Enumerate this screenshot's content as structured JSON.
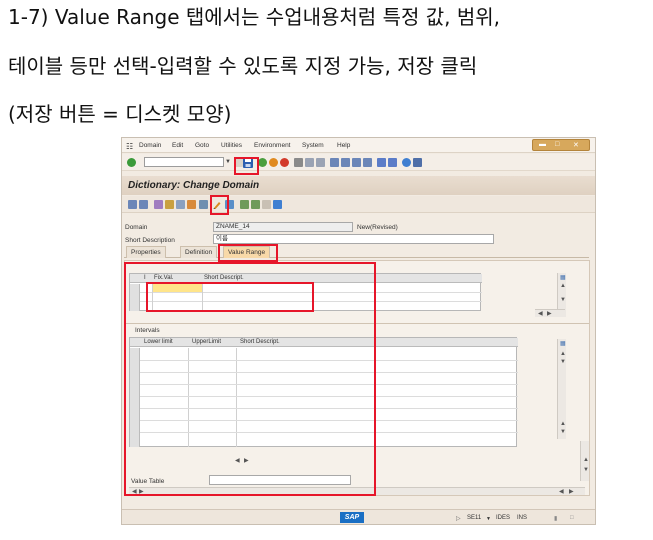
{
  "caption": {
    "line1": "1-7) Value Range 탭에서는 수업내용처럼 특정 값, 범위,",
    "line2": "테이블 등만 선택-입력할 수 있도록 지정 가능, 저장 클릭",
    "line3": "(저장 버튼 = 디스켓 모양)"
  },
  "menu": [
    "Domain",
    "Edit",
    "Goto",
    "Utilities",
    "Environment",
    "System",
    "Help"
  ],
  "toolbar": {
    "save_icon": "floppy-disk-icon"
  },
  "screen_title": "Dictionary: Change Domain",
  "application_toolbar": {
    "edit_icon": "pencil-icon"
  },
  "fields": {
    "domain_label": "Domain",
    "domain_value": "ZNAME_14",
    "domain_status": "New(Revised)",
    "short_desc_label": "Short Description",
    "short_desc_value": "이름"
  },
  "tabs": [
    "Properties",
    "Definition",
    "Value Range"
  ],
  "active_tab": "Value Range",
  "fixed_values_table": {
    "columns": [
      "I",
      "Fix.Val.",
      "Short Descript."
    ]
  },
  "intervals": {
    "title": "Intervals",
    "columns": [
      "Lower limit",
      "UpperLimit",
      "Short Descript."
    ]
  },
  "value_table": {
    "label": "Value Table",
    "value": ""
  },
  "status_bar": {
    "logo": "SAP",
    "transaction": "SE11",
    "system": "IDES",
    "mode": "INS"
  },
  "colors": {
    "highlight": "#e6162a",
    "selected_cell": "#ffe58a",
    "active_tab": "#f8d9a8",
    "title_background": "#e3d6c7"
  }
}
